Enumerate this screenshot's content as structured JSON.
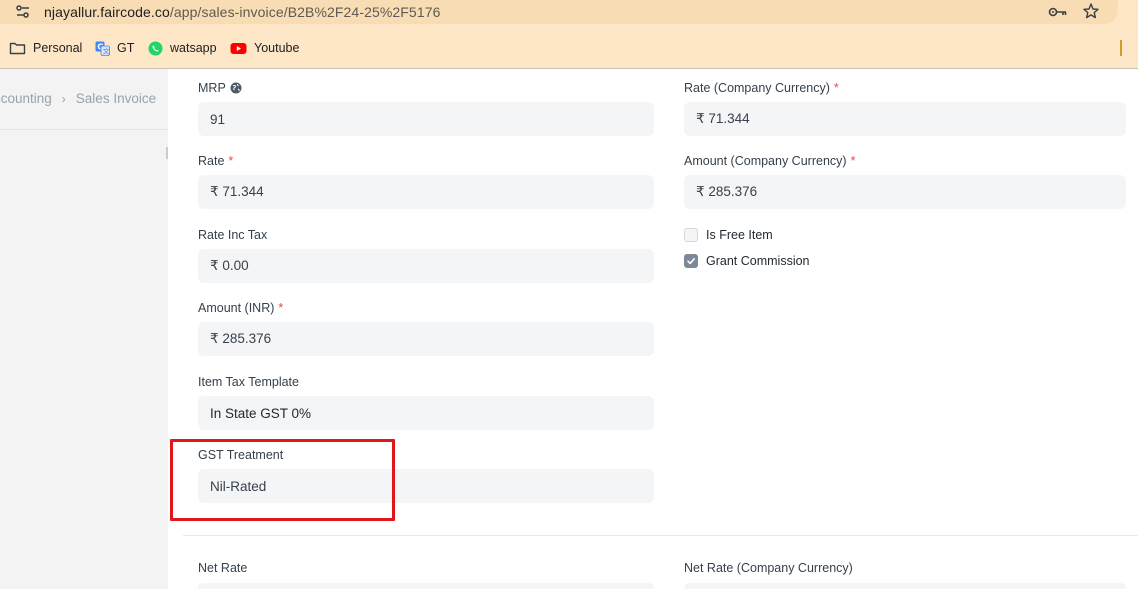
{
  "browser": {
    "url_host": "njayallur.faircode.co",
    "url_path": "/app/sales-invoice/B2B%2F24-25%2F5176",
    "bookmarks": [
      {
        "label": "Personal",
        "icon": "folder-icon"
      },
      {
        "label": "GT",
        "icon": "translate-icon"
      },
      {
        "label": "watsapp",
        "icon": "whatsapp-icon"
      },
      {
        "label": "Youtube",
        "icon": "youtube-icon"
      }
    ]
  },
  "breadcrumb": {
    "items": [
      "ccounting",
      "Sales Invoice"
    ],
    "separator": "›"
  },
  "left_column": {
    "mrp": {
      "label": "MRP",
      "value": "91"
    },
    "rate": {
      "label": "Rate",
      "required": "*",
      "value": "₹ 71.344"
    },
    "rate_inc_tax": {
      "label": "Rate Inc Tax",
      "value": "₹ 0.00"
    },
    "amount_inr": {
      "label": "Amount (INR)",
      "required": "*",
      "value": "₹ 285.376"
    },
    "item_tax_template": {
      "label": "Item Tax Template",
      "value": "In State GST 0%"
    },
    "gst_treatment": {
      "label": "GST Treatment",
      "value": "Nil-Rated"
    },
    "net_rate": {
      "label": "Net Rate"
    }
  },
  "right_column": {
    "rate_company_currency": {
      "label": "Rate (Company Currency)",
      "required": "*",
      "value": "₹ 71.344"
    },
    "amount_company_currency": {
      "label": "Amount (Company Currency)",
      "required": "*",
      "value": "₹ 285.376"
    },
    "is_free_item": {
      "label": "Is Free Item",
      "checked": false
    },
    "grant_commission": {
      "label": "Grant Commission",
      "checked": true
    },
    "net_rate_company_currency": {
      "label": "Net Rate (Company Currency)"
    }
  },
  "colors": {
    "highlight": "#e0161b",
    "required": "#e24c4c",
    "chrome_bg": "#fde7c7"
  }
}
